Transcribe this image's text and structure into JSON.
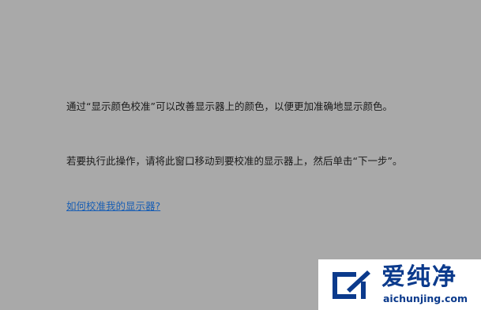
{
  "wizard": {
    "paragraph1": "通过“显示颜色校准”可以改善显示器上的颜色，以便更加准确地显示颜色。",
    "paragraph2": "若要执行此操作，请将此窗口移动到要校准的显示器上，然后单击“下一步”。",
    "help_link": "如何校准我的显示器?"
  },
  "watermark": {
    "title": "爱纯净",
    "url": "aichunjing.com"
  },
  "colors": {
    "background": "#a9a9a9",
    "link": "#1a5fb4",
    "brand": "#0b3a8c"
  }
}
